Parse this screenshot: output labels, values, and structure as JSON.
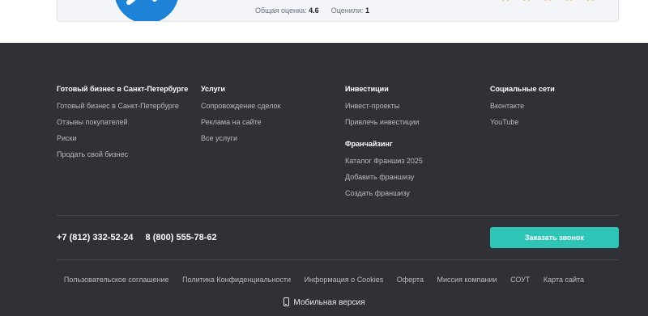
{
  "card": {
    "rating_label": "Общая оценка:",
    "rating_value": "4.6",
    "votes_label": "Оценили:",
    "votes_value": "1",
    "stars": 5,
    "star_color": "#f5c24a",
    "logo_color": "#1e83d6"
  },
  "footer": {
    "columns": [
      {
        "title": "Готовый бизнес в Санкт-Петербурге",
        "links": [
          "Готовый бизнес в Санкт-Петербурге",
          "Отзывы покупателей",
          "Риски",
          "Продать свой бизнес"
        ]
      },
      {
        "title": "Услуги",
        "links": [
          "Сопровождение сделок",
          "Реклама на сайте",
          "Все услуги"
        ]
      },
      {
        "title": "Инвестиции",
        "links": [
          "Инвест-проекты",
          "Привлечь инвестиции"
        ],
        "sub_title": "Франчайзинг",
        "sub_links": [
          "Каталог Франшиз 2025",
          "Добавить франшизу",
          "Создать франшизу"
        ]
      },
      {
        "title": "Социальные сети",
        "links": [
          "Вконтакте",
          "YouTube"
        ]
      }
    ],
    "phones": [
      "+7 (812) 332-52-24",
      "8 (800) 555-78-62"
    ],
    "call_button": "Заказать звонок",
    "bottom_links": [
      "Пользовательское соглашение",
      "Политика Конфиденциальности",
      "Информация о Cookies",
      "Оферта",
      "Миссия компании",
      "СОУТ",
      "Карта сайта"
    ],
    "mobile_version": "Мобильная версия",
    "colors": {
      "background": "#2f3137",
      "accent": "#2ec5b6"
    }
  }
}
